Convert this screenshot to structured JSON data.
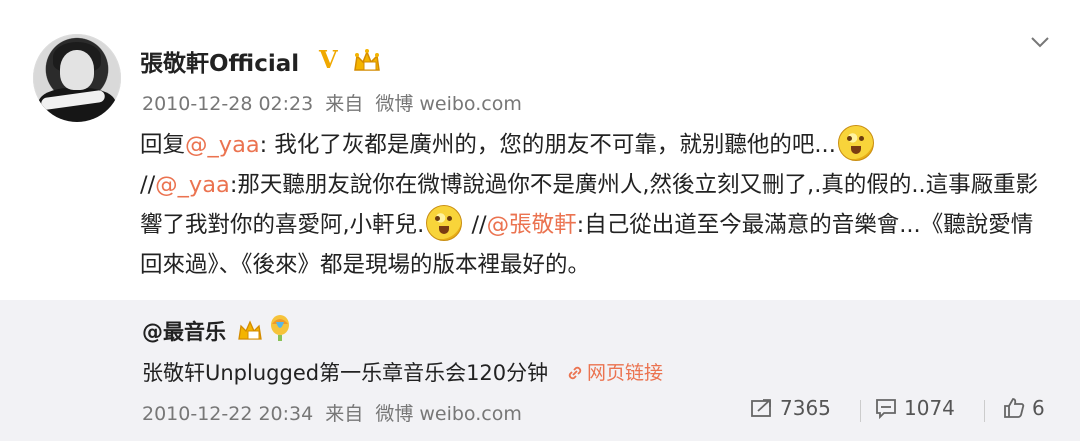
{
  "post": {
    "username": "張敬軒Official",
    "verified_badge": "V",
    "crown_icon": "crown-icon",
    "timestamp": "2010-12-28 02:23",
    "source_prefix": "来自",
    "source": "微博 weibo.com",
    "menu_icon": "chevron-down-icon",
    "content": {
      "line1_prefix": "回复",
      "line1_mention": "@_yaa",
      "line1_text": ": 我化了灰都是廣州的，您的朋友不可靠，就别聽他的吧...",
      "line2_prefix": "//",
      "line2_mention": "@_yaa",
      "line2_text": ":那天聽朋友說你在微博說過你不是廣州人,然後立刻又刪了,.真的假的..這事厰重影響了我對你的喜愛阿,小軒兒.",
      "line3_prefix": " //",
      "line3_mention": "@張敬軒",
      "line3_text": ":自己從出道至今最滿意的音樂會...《聽說愛情回來過》、《後來》都是現場的版本裡最好的。"
    }
  },
  "repost": {
    "username": "@最音乐",
    "text": "张敬轩Unplugged第一乐章音乐会120分钟",
    "link_label": "网页链接",
    "timestamp": "2010-12-22 20:34",
    "source_prefix": "来自",
    "source": "微博 weibo.com",
    "stats": {
      "reposts": "7365",
      "comments": "1074",
      "likes": "6"
    }
  },
  "colors": {
    "accent": "#eb7350",
    "repost_background": "#f2f2f5",
    "verified": "#f0a800"
  }
}
